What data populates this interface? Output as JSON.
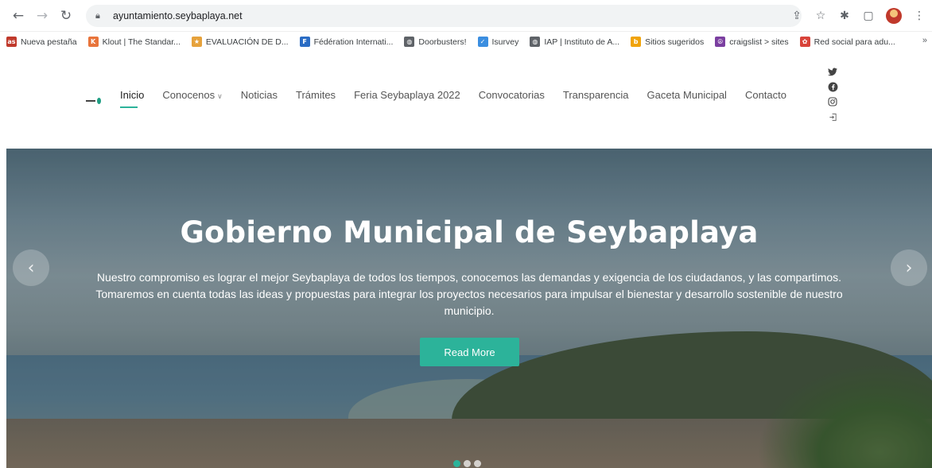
{
  "browser": {
    "url": "ayuntamiento.seybaplaya.net"
  },
  "bookmarks": [
    {
      "label": "Nueva pestaña",
      "icon": "as-icon",
      "color": "#c0392b",
      "glyph": "as"
    },
    {
      "label": "Klout | The Standar...",
      "icon": "klout-icon",
      "color": "#e8743b",
      "glyph": "K"
    },
    {
      "label": "EVALUACIÓN DE D...",
      "icon": "medal-icon",
      "color": "#e6a23c",
      "glyph": "★"
    },
    {
      "label": "Fédération Internati...",
      "icon": "f-icon",
      "color": "#2a6cc4",
      "glyph": "F"
    },
    {
      "label": "Doorbusters!",
      "icon": "globe-icon",
      "color": "#5f6368",
      "glyph": "◍"
    },
    {
      "label": "Isurvey",
      "icon": "check-icon",
      "color": "#3b8ee0",
      "glyph": "✓"
    },
    {
      "label": "IAP | Instituto de A...",
      "icon": "globe-icon",
      "color": "#5f6368",
      "glyph": "◍"
    },
    {
      "label": "Sitios sugeridos",
      "icon": "bing-icon",
      "color": "#f0a30a",
      "glyph": "b"
    },
    {
      "label": "craigslist > sites",
      "icon": "peace-icon",
      "color": "#7b3fa0",
      "glyph": "☮"
    },
    {
      "label": "Red social para adu...",
      "icon": "social-icon",
      "color": "#d8433a",
      "glyph": "✿"
    }
  ],
  "bookmarks_more": "»",
  "nav": {
    "items": [
      {
        "label": "Inicio",
        "active": true
      },
      {
        "label": "Conocenos",
        "has_dropdown": true
      },
      {
        "label": "Noticias"
      },
      {
        "label": "Trámites"
      },
      {
        "label": "Feria Seybaplaya 2022"
      },
      {
        "label": "Convocatorias"
      },
      {
        "label": "Transparencia"
      },
      {
        "label": "Gaceta Municipal"
      },
      {
        "label": "Contacto"
      }
    ],
    "social": [
      "twitter-icon",
      "facebook-icon",
      "instagram-icon",
      "login-icon"
    ]
  },
  "hero": {
    "title": "Gobierno Municipal de Seybaplaya",
    "text": "Nuestro compromiso es lograr el mejor Seybaplaya de todos los tiempos, conocemos las demandas y exigencia de los ciudadanos, y las compartimos. Tomaremos en cuenta todas las ideas y propuestas para integrar los proyectos necesarios para impulsar el bienestar y desarrollo sostenible de nuestro municipio.",
    "button": "Read More",
    "slides": 3,
    "active_slide": 1
  },
  "colors": {
    "accent": "#2cb39a"
  }
}
